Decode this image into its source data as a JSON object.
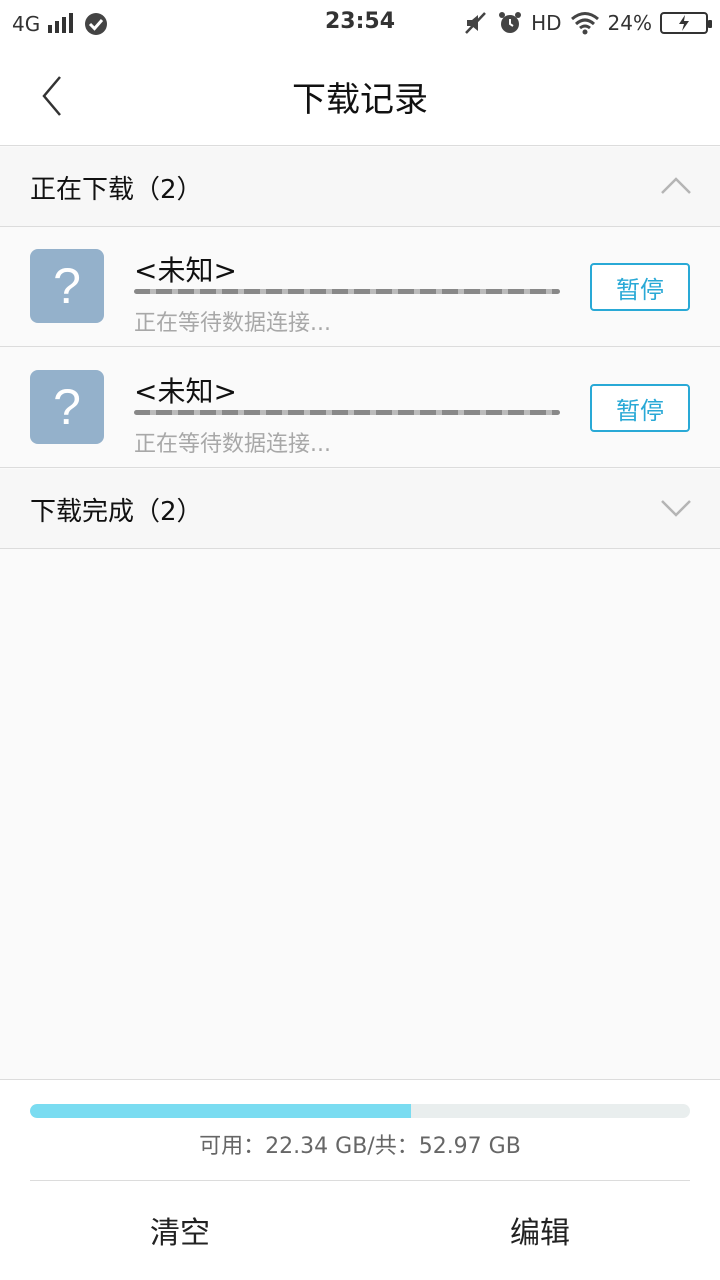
{
  "status_bar": {
    "network": "4G",
    "time": "23:54",
    "hd": "HD",
    "battery": "24%"
  },
  "nav": {
    "title": "下载记录"
  },
  "sections": {
    "downloading": {
      "label": "正在下载（2）",
      "expanded": true
    },
    "completed": {
      "label": "下载完成（2）",
      "expanded": false
    }
  },
  "downloads": [
    {
      "name": "<未知>",
      "status": "正在等待数据连接...",
      "action": "暂停",
      "icon": "question-mark-icon"
    },
    {
      "name": "<未知>",
      "status": "正在等待数据连接...",
      "action": "暂停",
      "icon": "question-mark-icon"
    }
  ],
  "storage": {
    "text": "可用：22.34 GB/共：52.97 GB",
    "used_fraction": 0.578,
    "fill_color": "#7adcf1"
  },
  "footer": {
    "clear_label": "清空",
    "edit_label": "编辑"
  },
  "colors": {
    "accent": "#29a9d6",
    "icon_bg": "#94b1cb"
  }
}
